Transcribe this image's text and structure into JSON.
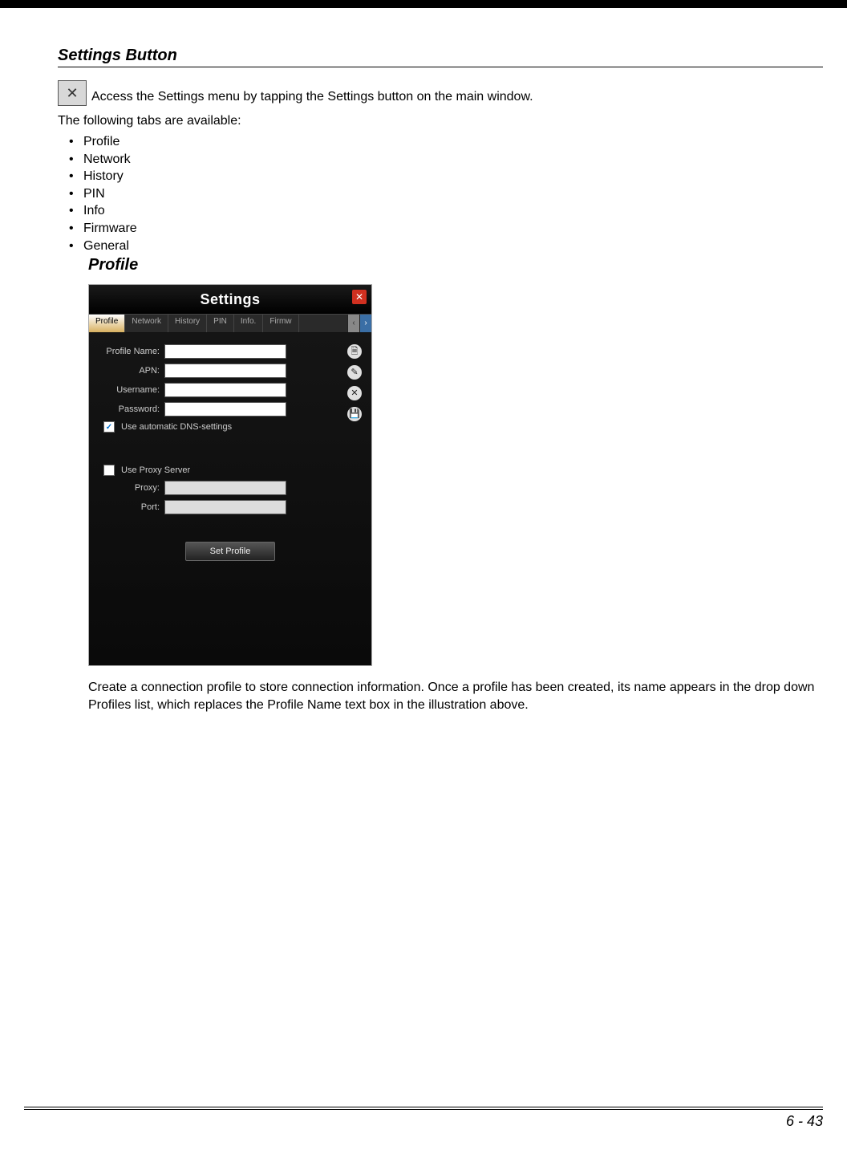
{
  "heading": "Settings Button",
  "intro": "Access the Settings menu by tapping the Settings button on the main window.",
  "tabs_intro": "The following tabs are available:",
  "tabs": [
    "Profile",
    "Network",
    "History",
    "PIN",
    "Info",
    "Firmware",
    "General"
  ],
  "subheading": "Profile",
  "screenshot": {
    "title": "Settings",
    "close": "✕",
    "tabrow": {
      "active": "Profile",
      "others": [
        "Network",
        "History",
        "PIN",
        "Info.",
        "Firmw"
      ],
      "arrow_left": "‹",
      "arrow_right": "›"
    },
    "fields": {
      "profile_name": "Profile Name:",
      "apn": "APN:",
      "username": "Username:",
      "password": "Password:"
    },
    "dns_checkbox": "Use automatic DNS-settings",
    "proxy_checkbox": "Use Proxy Server",
    "proxy_label": "Proxy:",
    "port_label": "Port:",
    "set_profile_btn": "Set Profile",
    "side_icons": {
      "new": "🗎",
      "edit": "✎",
      "delete": "✕",
      "save": "💾"
    }
  },
  "caption": "Create a connection profile to store connection information. Once a profile has been created, its name appears in the drop down Profiles list, which replaces the Profile Name text box in the illustration above.",
  "page_number": "6 - 43"
}
